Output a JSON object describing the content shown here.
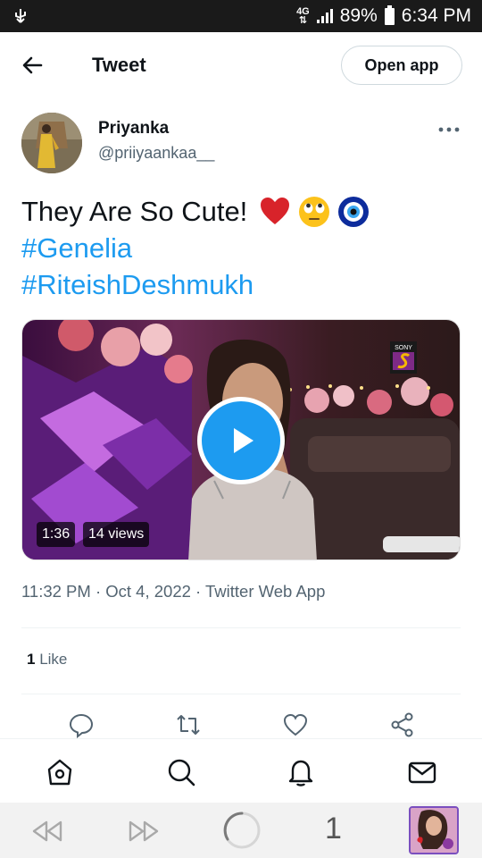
{
  "status_bar": {
    "network": "4G",
    "battery": "89%",
    "time": "6:34 PM"
  },
  "header": {
    "title": "Tweet",
    "open_app_label": "Open app"
  },
  "author": {
    "name": "Priyanka",
    "handle": "@priiyaankaa__"
  },
  "tweet": {
    "text": "They Are So Cute!",
    "emojis": [
      "red-heart",
      "face-with-rolling-eyes",
      "nazar-amulet"
    ],
    "hashtags": [
      "#Genelia",
      "#RiteishDeshmukh"
    ]
  },
  "video": {
    "duration": "1:36",
    "views": "14 views",
    "channel_logo": "SONY"
  },
  "meta": {
    "line": "11:32 PM · Oct 4, 2022 · Twitter Web App"
  },
  "stats": {
    "likes_count": "1",
    "likes_label": "Like"
  },
  "actions": [
    "reply-icon",
    "retweet-icon",
    "like-icon",
    "share-icon"
  ],
  "bottom_nav": [
    "home-icon",
    "search-icon",
    "notifications-icon",
    "messages-icon"
  ],
  "browser": {
    "tab_count": "1"
  },
  "colors": {
    "accent": "#1d9bf0",
    "text": "#0f1419",
    "secondary": "#536471",
    "status_bar": "#1a1a1a"
  }
}
